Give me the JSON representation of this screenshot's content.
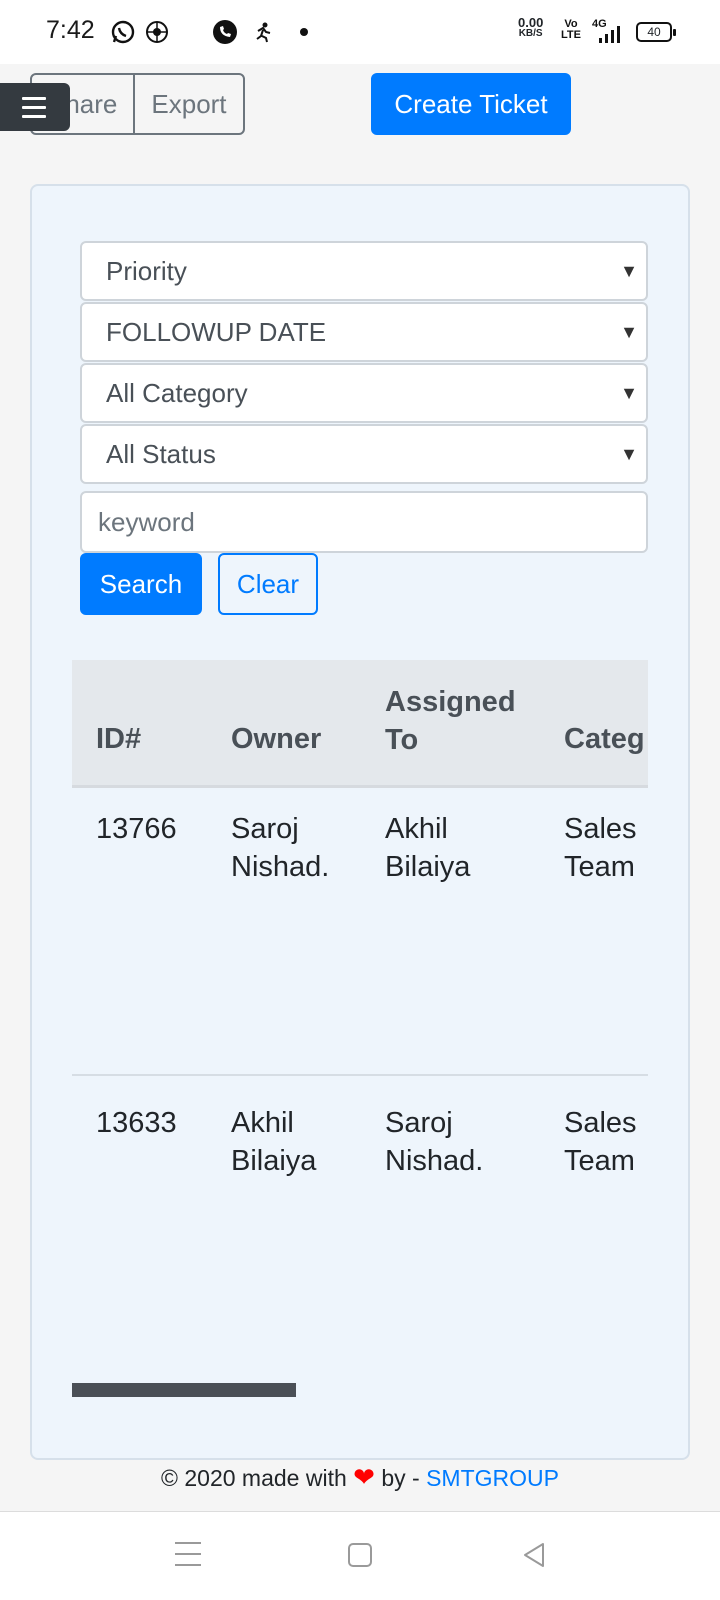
{
  "status_bar": {
    "time": "7:42",
    "speed_value": "0.00",
    "speed_unit": "KB/S",
    "network_vo": "Vo",
    "network_lte": "LTE",
    "network_gen": "4G",
    "battery": "40",
    "icons": [
      "whatsapp-icon",
      "app-icon",
      "phone-call-icon",
      "runner-icon",
      "dot-icon",
      "signal-icon",
      "battery-icon"
    ]
  },
  "toolbar": {
    "share_label": "Share",
    "export_label": "Export",
    "create_ticket_label": "Create Ticket"
  },
  "filters": {
    "priority": "Priority",
    "followup_date": "FOLLOWUP DATE",
    "category": "All Category",
    "status": "All Status",
    "keyword_placeholder": "keyword",
    "search_label": "Search",
    "clear_label": "Clear"
  },
  "table": {
    "columns": [
      "ID#",
      "Owner",
      "Assigned To",
      "Categ"
    ],
    "header_lines": {
      "id": "ID#",
      "owner": "Owner",
      "assigned_line1": "Assigned",
      "assigned_line2": "To",
      "category": "Categ"
    },
    "rows": [
      {
        "id": "13766",
        "owner_line1": "Saroj",
        "owner_line2": "Nishad.",
        "assigned_line1": "Akhil",
        "assigned_line2": "Bilaiya",
        "category_line1": "Sales",
        "category_line2": "Team"
      },
      {
        "id": "13633",
        "owner_line1": "Akhil",
        "owner_line2": "Bilaiya",
        "assigned_line1": "Saroj",
        "assigned_line2": "Nishad.",
        "category_line1": "Sales",
        "category_line2": "Team"
      }
    ]
  },
  "footer": {
    "prefix": "© 2020 made with",
    "middle": "by -",
    "brand": "SMTGROUP"
  },
  "colors": {
    "primary": "#007bff",
    "heart": "#ff0000",
    "card_bg": "#eef5fc"
  }
}
